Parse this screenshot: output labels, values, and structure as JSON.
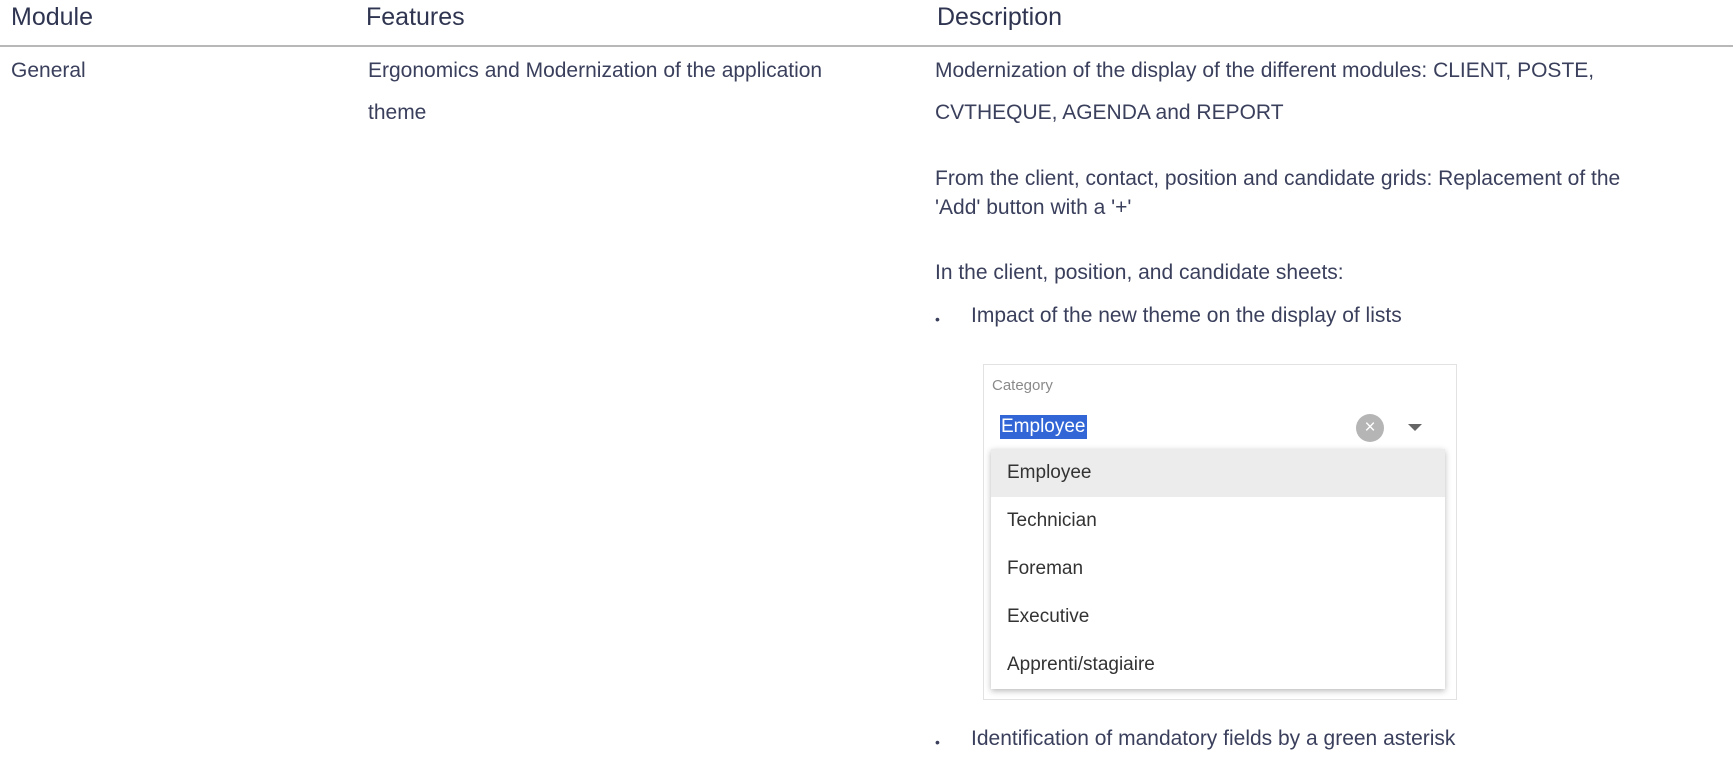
{
  "table": {
    "headers": [
      "Module",
      "Features",
      "Description"
    ],
    "row": {
      "module": "General",
      "feature_line1": "Ergonomics and Modernization of the application",
      "feature_line2": "theme",
      "desc_p1_line1": "Modernization of the display of the different modules: CLIENT, POSTE,",
      "desc_p1_line2": "CVTHEQUE, AGENDA and REPORT",
      "desc_p2_line1": "From the client, contact, position and candidate grids: Replacement of the",
      "desc_p2_line2": "'Add' button with a '+'",
      "desc_p3": "In the client, position, and candidate sheets:",
      "bullets": [
        "Impact of the new theme on the display of lists",
        "Identification of mandatory fields by a green asterisk"
      ]
    }
  },
  "dropdown_example": {
    "label": "Category",
    "selected_value": "Employee",
    "clear_icon": "×",
    "options": [
      "Employee",
      "Technician",
      "Foreman",
      "Executive",
      "Apprenti/stagiaire"
    ]
  },
  "bullet_glyph": "•"
}
